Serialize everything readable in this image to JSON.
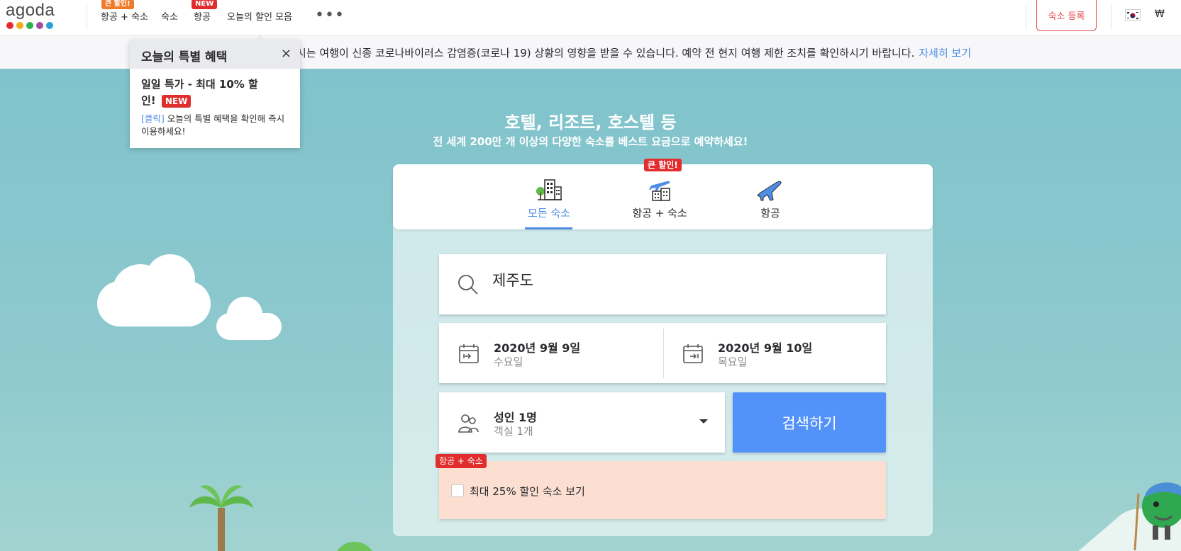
{
  "header": {
    "logo_text": "agoda",
    "logo_dot_colors": [
      "#e12d2d",
      "#f0ac1a",
      "#2ab151",
      "#a04ea0",
      "#2a9fd8"
    ],
    "nav": [
      {
        "label": "항공 + 숙소",
        "badge": "큰 할인!"
      },
      {
        "label": "숙소"
      },
      {
        "label": "항공",
        "badge": "NEW"
      },
      {
        "label": "오늘의 할인 모음"
      }
    ],
    "more_label": "•••",
    "host_button": "숙소 등록",
    "currency": "₩"
  },
  "notice": {
    "text": "시는 여행이 신종 코로나바이러스 감염증(코로나 19) 상황의 영향을 받을 수 있습니다. 예약 전 현지 여행 제한 조치를 확인하시기 바랍니다.",
    "link": "자세히 보기"
  },
  "popover": {
    "title": "오늘의 특별 혜택",
    "close": "×",
    "deal": "일일 특가 - 최대 10% 할인!",
    "new_badge": "NEW",
    "desc_link": "[클릭]",
    "desc": " 오늘의 특별 혜택을 확인해 즉시 이용하세요!"
  },
  "hero": {
    "title": "호텔, 리조트, 호스텔 등",
    "subtitle": "전 세계 200만 개 이상의 다양한 숙소를 베스트 요금으로 예약하세요!"
  },
  "tabs": [
    {
      "label": "모든 숙소",
      "active": true
    },
    {
      "label": "항공 + 숙소",
      "badge": "큰 할인!"
    },
    {
      "label": "항공"
    }
  ],
  "search": {
    "destination": "제주도",
    "checkin": {
      "date": "2020년 9월 9일",
      "weekday": "수요일"
    },
    "checkout": {
      "date": "2020년 9월 10일",
      "weekday": "목요일"
    },
    "occupancy": {
      "guests": "성인 1명",
      "rooms": "객실 1개"
    },
    "button": "검색하기"
  },
  "promo": {
    "badge": "항공 + 숙소",
    "label": "최대 25% 할인 숙소 보기",
    "checked": false
  },
  "colors": {
    "accent": "#5392f9",
    "link": "#4e8ee5",
    "badge_red": "#e12d2d",
    "host_button": "#e6484b",
    "hero_top": "#80c3cc",
    "promo_bg": "#fddfd1"
  }
}
